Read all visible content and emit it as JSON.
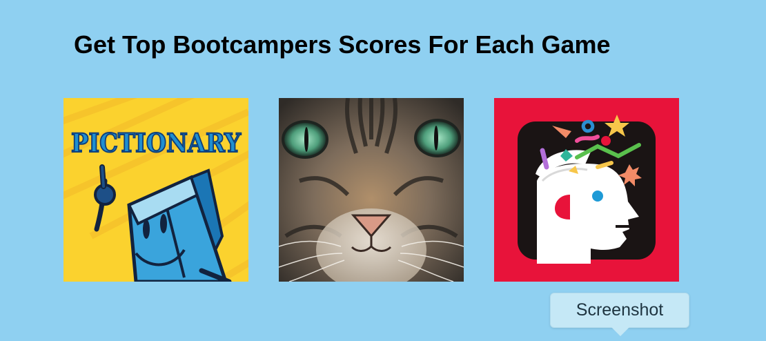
{
  "page": {
    "title": "Get Top Bootcampers Scores For Each Game",
    "background_color": "#8fd0f1"
  },
  "games": [
    {
      "name": "Pictionary",
      "logo_text": "PICTIONARY",
      "icon": "pictionary-icon"
    },
    {
      "name": "Cat",
      "icon": "cat-face-image"
    },
    {
      "name": "Mind game",
      "icon": "party-head-icon"
    }
  ],
  "tooltip": {
    "label": "Screenshot"
  },
  "colors": {
    "pictionary_bg": "#fbd22e",
    "mind_bg": "#e8133a",
    "tooltip_bg": "#c5e8f6"
  }
}
